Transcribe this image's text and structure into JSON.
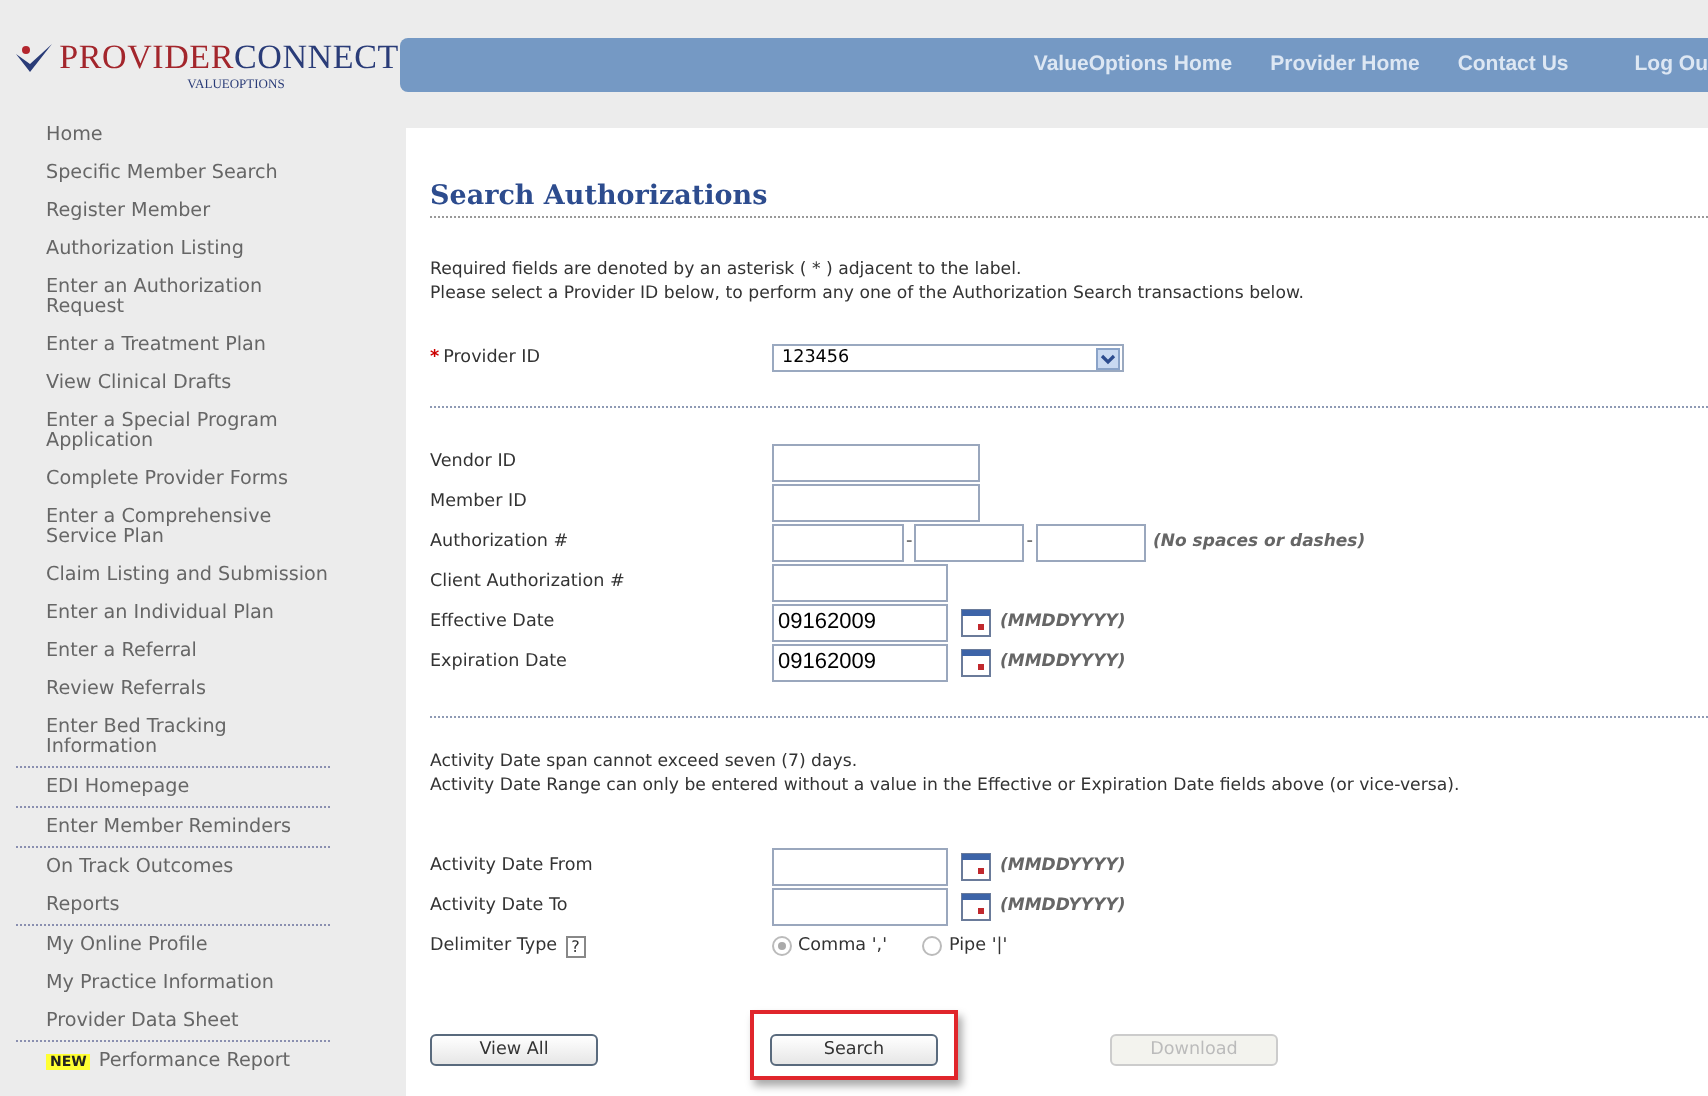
{
  "logo": {
    "brand_first": "PROVIDER",
    "brand_second": "CONNECT",
    "tagline": "VALUEOPTIONS"
  },
  "top_nav": [
    "ValueOptions Home",
    "Provider Home",
    "Contact Us",
    "Log Ou"
  ],
  "sidebar": {
    "sections": [
      {
        "items": [
          {
            "label": "Home"
          },
          {
            "label": "Specific Member Search"
          },
          {
            "label": "Register Member"
          },
          {
            "label": "Authorization Listing"
          },
          {
            "label": "Enter an Authorization Request"
          },
          {
            "label": "Enter a Treatment Plan"
          },
          {
            "label": "View Clinical Drafts"
          },
          {
            "label": "Enter a Special Program Application"
          },
          {
            "label": "Complete Provider Forms"
          },
          {
            "label": "Enter a Comprehensive Service Plan"
          },
          {
            "label": "Claim Listing and Submission"
          },
          {
            "label": "Enter an Individual Plan"
          },
          {
            "label": "Enter a Referral"
          },
          {
            "label": "Review Referrals"
          },
          {
            "label": "Enter Bed Tracking Information"
          }
        ]
      },
      {
        "items": [
          {
            "label": "EDI Homepage"
          }
        ]
      },
      {
        "items": [
          {
            "label": "Enter Member Reminders"
          }
        ]
      },
      {
        "items": [
          {
            "label": "On Track Outcomes"
          },
          {
            "label": "Reports"
          }
        ]
      },
      {
        "items": [
          {
            "label": "My Online Profile"
          },
          {
            "label": "My Practice Information"
          },
          {
            "label": "Provider Data Sheet"
          }
        ]
      },
      {
        "items": [
          {
            "label": "Performance Report",
            "badge": "NEW"
          }
        ]
      }
    ]
  },
  "page": {
    "title": "Search Authorizations",
    "intro": [
      "Required fields are denoted by an asterisk ( * ) adjacent to the label.",
      "Please select a Provider ID below, to perform any one of the Authorization Search transactions below."
    ],
    "provider": {
      "required_mark": "*",
      "label": "Provider ID",
      "value": "123456"
    },
    "fields": [
      {
        "kind": "text",
        "label": "Vendor ID"
      },
      {
        "kind": "text",
        "label": "Member ID"
      },
      {
        "kind": "auth",
        "label": "Authorization #",
        "separator": "-",
        "hint": "(No spaces or dashes)"
      },
      {
        "kind": "short",
        "label": "Client Authorization #"
      },
      {
        "kind": "date",
        "label": "Effective Date",
        "value": "09162009",
        "hint": "(MMDDYYYY)"
      },
      {
        "kind": "date",
        "label": "Expiration Date",
        "value": "09162009",
        "hint": "(MMDDYYYY)"
      }
    ],
    "activity_notes": [
      "Activity Date span cannot exceed seven (7) days.",
      "Activity Date Range can only be entered without a value in the Effective or Expiration Date fields above (or vice-versa)."
    ],
    "activity_fields": [
      {
        "kind": "date",
        "label": "Activity Date From",
        "hint": "(MMDDYYYY)"
      },
      {
        "kind": "date",
        "label": "Activity Date To",
        "hint": "(MMDDYYYY)"
      }
    ],
    "delimiter": {
      "label": "Delimiter Type",
      "help": "?",
      "options": [
        {
          "label": "Comma ','",
          "selected": true
        },
        {
          "label": "Pipe '|'",
          "selected": false
        }
      ]
    },
    "buttons": [
      {
        "label": "View All",
        "disabled": false,
        "highlighted": false
      },
      {
        "label": "Search",
        "disabled": false,
        "highlighted": true
      },
      {
        "label": "Download",
        "disabled": true,
        "highlighted": false
      }
    ]
  }
}
